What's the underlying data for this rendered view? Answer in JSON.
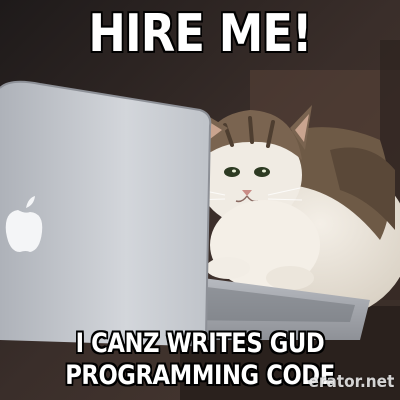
{
  "meme": {
    "top_text": "HIRE ME!",
    "bottom_text_line1": "I CANZ WRITES GUD",
    "bottom_text_line2": "PROGRAMMING CODE",
    "watermark": "erator.net"
  },
  "scene": {
    "subject": "cat",
    "prop": "laptop",
    "colors": {
      "background": "#3a2e2a",
      "laptop_silver": "#c9ccd2",
      "cat_white": "#f0ebe3",
      "cat_brown": "#6e5a46",
      "desk": "#2a211d"
    }
  }
}
